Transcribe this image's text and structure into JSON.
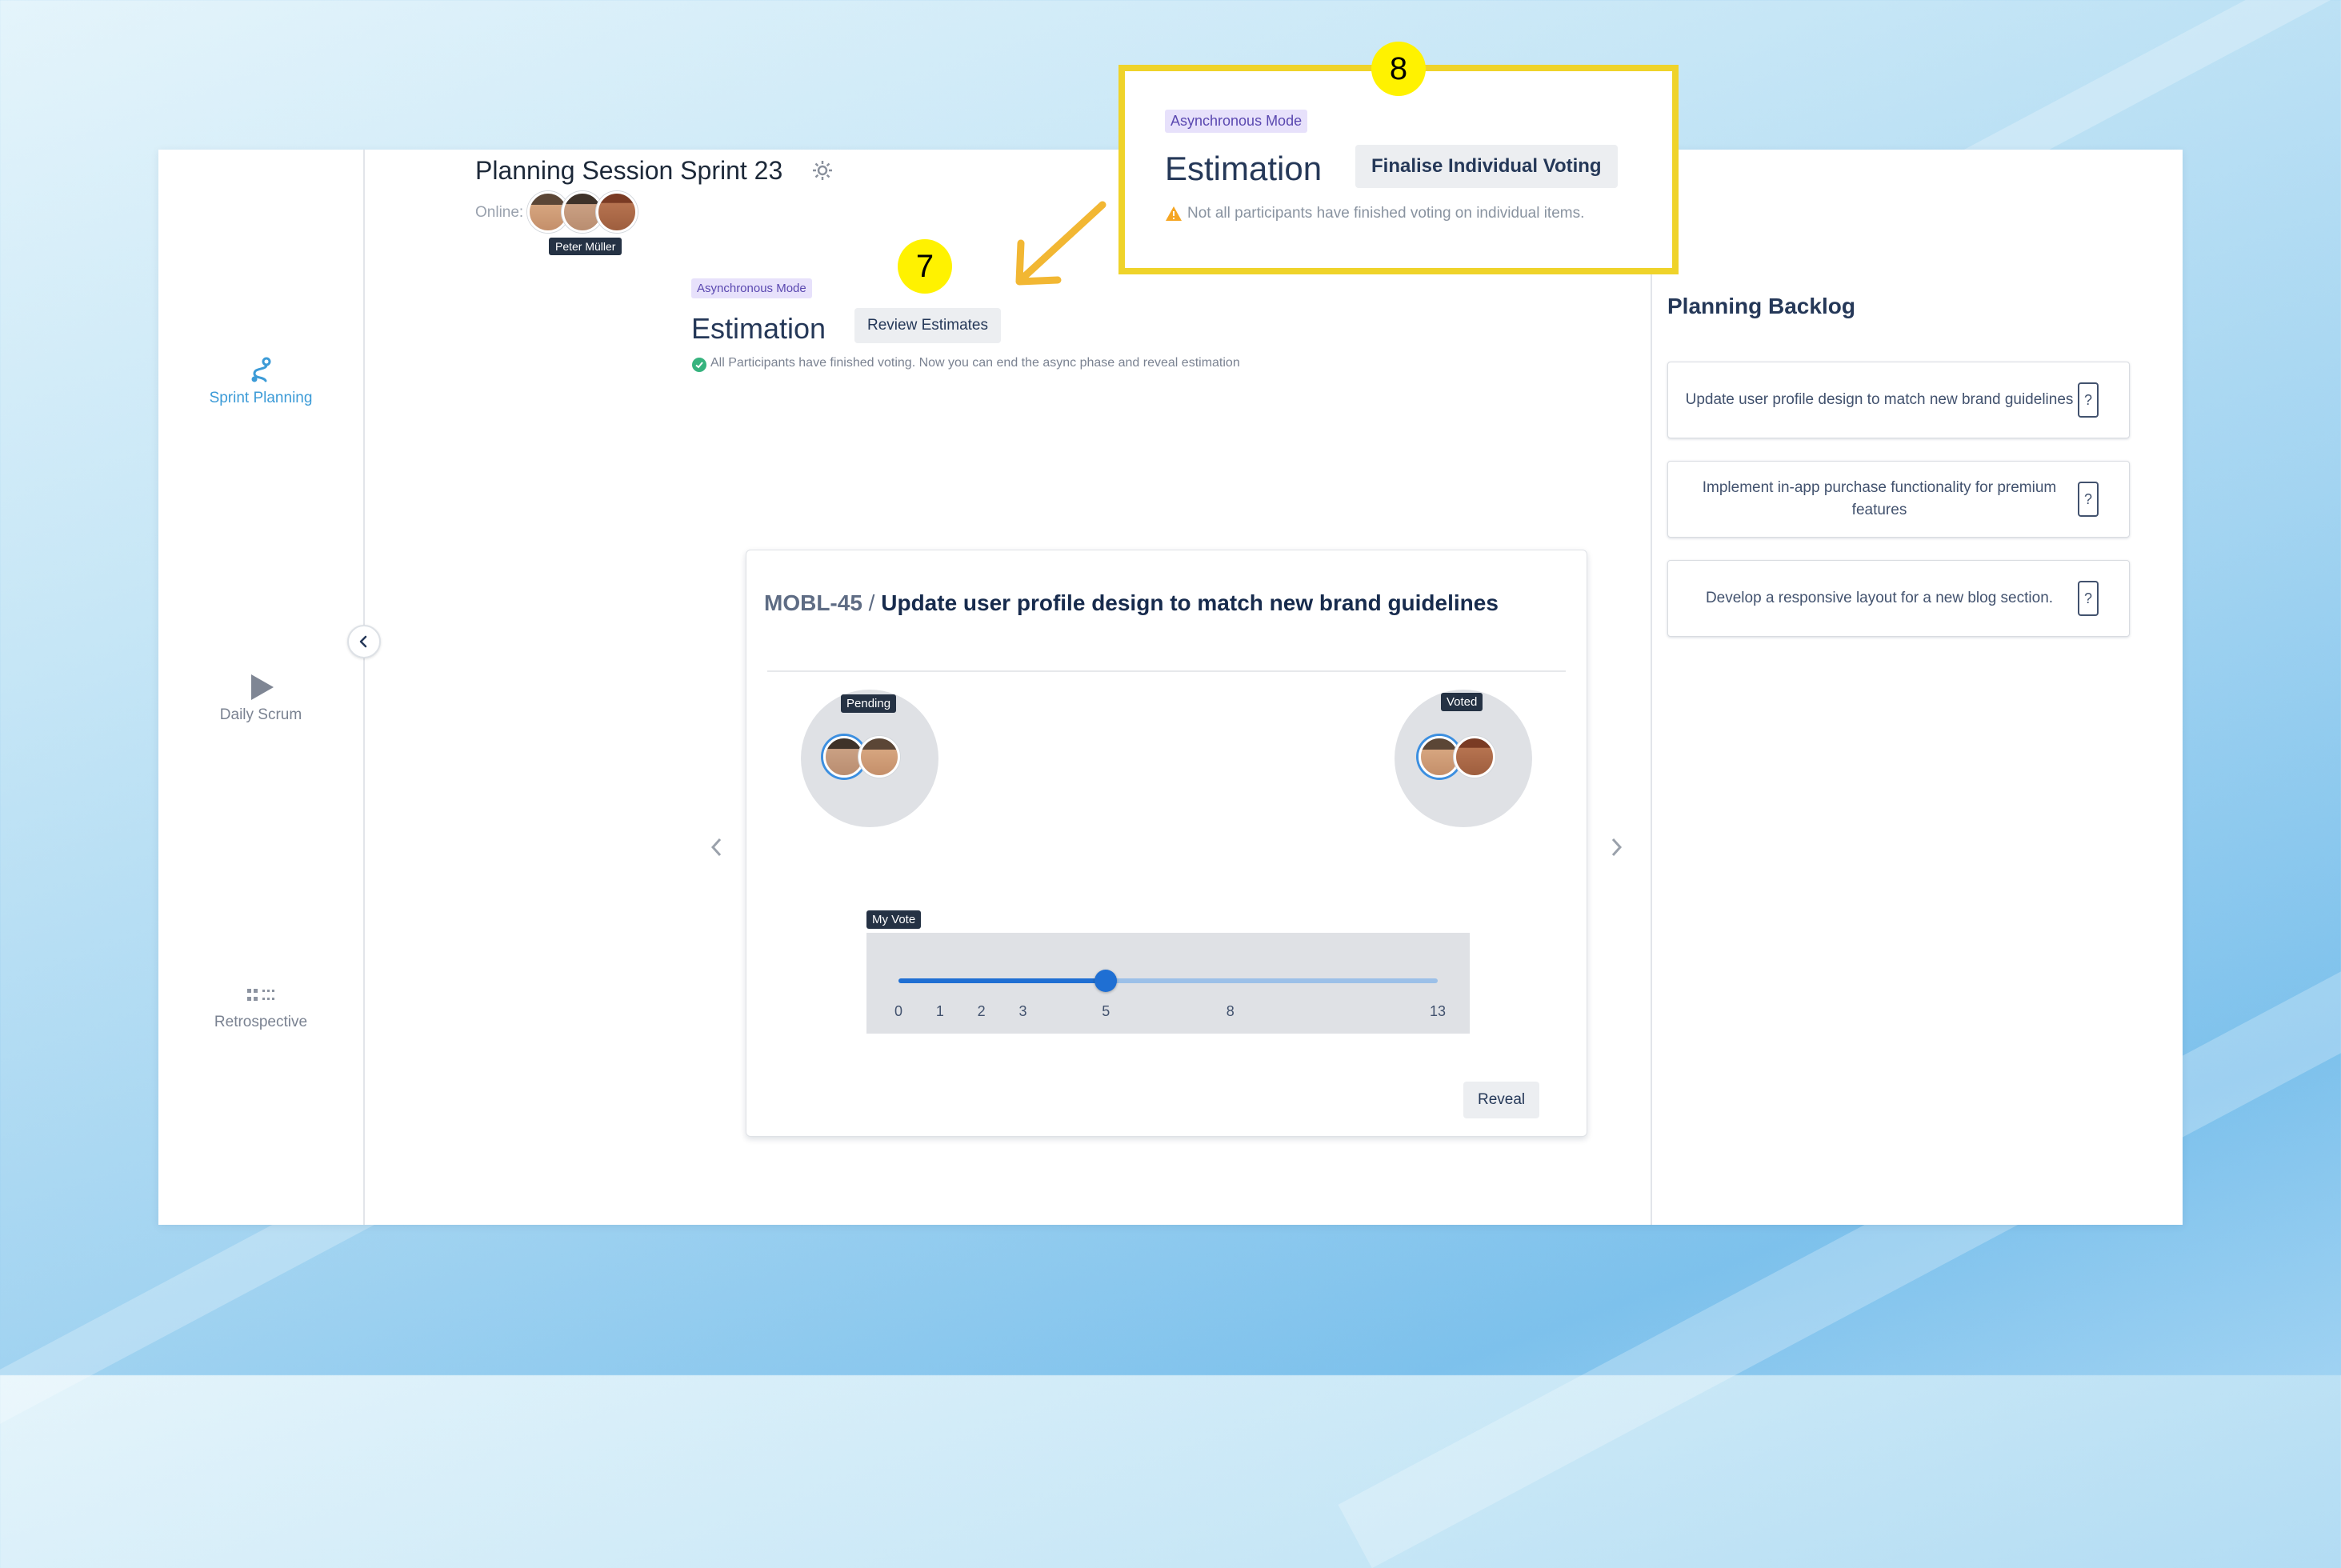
{
  "colors": {
    "accent": "#3c9bd7",
    "slider_active": "#1f6fd3",
    "highlight_border": "#efd32a",
    "annotation_badge": "#fff200",
    "arrow": "#f2b733",
    "lozenge_bg": "#e7e1fb",
    "success": "#36b37e",
    "warning": "#f5a623"
  },
  "nav": {
    "items": [
      {
        "label": "Sprint Planning",
        "icon": "sprint-planning-icon",
        "active": true
      },
      {
        "label": "Daily Scrum",
        "icon": "play-icon",
        "active": false
      },
      {
        "label": "Retrospective",
        "icon": "grid-dots-icon",
        "active": false
      }
    ],
    "collapse_icon": "chevron-left-icon"
  },
  "header": {
    "title": "Planning Session Sprint 23",
    "settings_icon": "gear-icon",
    "online_label": "Online:",
    "tooltip": "Peter Müller"
  },
  "estimation": {
    "mode_label": "Asynchronous Mode",
    "title": "Estimation",
    "review_button": "Review Estimates",
    "status_message": "All Participants have finished voting. Now you can end the async phase and reveal estimation"
  },
  "callout": {
    "mode_label": "Asynchronous Mode",
    "title": "Estimation",
    "finalise_button": "Finalise Individual Voting",
    "warning_message": "Not all participants have finished voting on individual items."
  },
  "annotations": {
    "badge_7": "7",
    "badge_8": "8"
  },
  "issue": {
    "key": "MOBL-45",
    "separator": " / ",
    "summary": "Update user profile design to match new brand guidelines",
    "pending_label": "Pending",
    "voted_label": "Voted",
    "my_vote_label": "My Vote",
    "scale": [
      "0",
      "1",
      "2",
      "3",
      "5",
      "8",
      "13"
    ],
    "selected_vote": "5",
    "reveal_button": "Reveal"
  },
  "backlog": {
    "title": "Planning Backlog",
    "items": [
      {
        "text": "Update user profile design to match new brand guidelines",
        "estimate": "?"
      },
      {
        "text": "Implement in-app purchase functionality for premium features",
        "estimate": "?"
      },
      {
        "text": "Develop a responsive layout for a new blog section.",
        "estimate": "?"
      }
    ]
  }
}
